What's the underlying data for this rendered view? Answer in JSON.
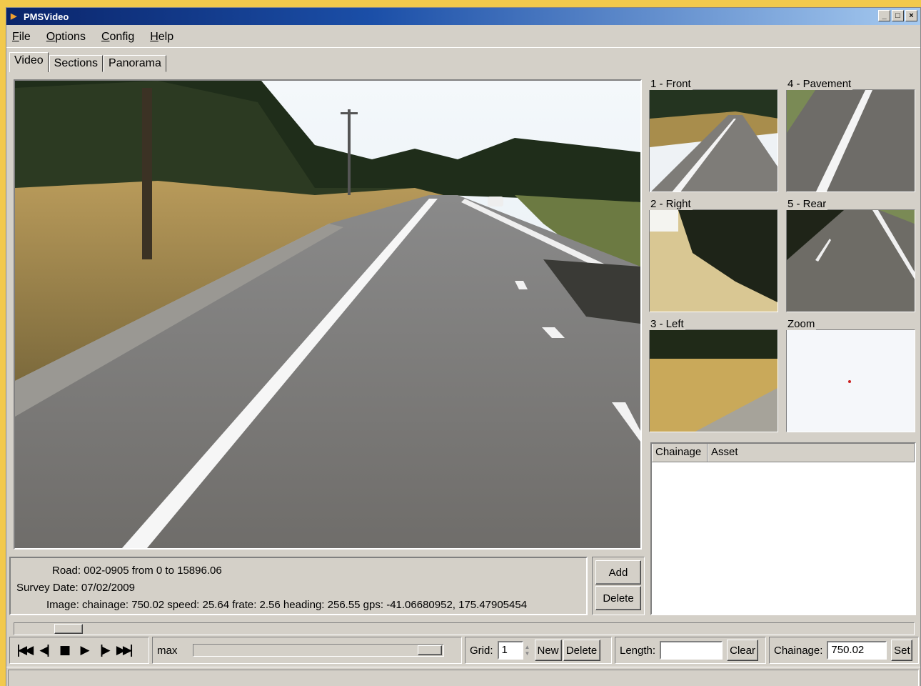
{
  "window": {
    "title": "PMSVideo",
    "controls": [
      "minimize",
      "maximize",
      "close"
    ]
  },
  "menu": {
    "items": [
      "File",
      "Options",
      "Config",
      "Help"
    ]
  },
  "tabs": [
    {
      "label": "Video",
      "active": true
    },
    {
      "label": "Sections"
    },
    {
      "label": "Panorama"
    }
  ],
  "cameras": {
    "front": "1 - Front",
    "right": "2 - Right",
    "left": "3 - Left",
    "pavement": "4 - Pavement",
    "rear": "5 - Rear",
    "zoom": "Zoom"
  },
  "asset_table": {
    "columns": [
      "Chainage",
      "Asset"
    ],
    "rows": []
  },
  "info": {
    "road": "Road: 002-0905 from 0 to 15896.06",
    "survey_date": "Survey Date: 07/02/2009",
    "image": "Image: chainage: 750.02   speed: 25.64   frate: 2.56   heading: 256.55   gps: -41.06680952, 175.47905454"
  },
  "buttons": {
    "add": "Add",
    "delete_asset": "Delete"
  },
  "playback": {
    "icons": [
      "skip-to-start-icon",
      "step-back-icon",
      "stop-icon",
      "play-icon",
      "step-forward-icon",
      "skip-to-end-icon"
    ],
    "glyphs": [
      "|◀◀",
      "◀|",
      "■",
      "▶",
      "|▶",
      "▶▶|"
    ],
    "speed_label": "max"
  },
  "grid": {
    "label": "Grid:",
    "value": "1",
    "new_label": "New",
    "delete_label": "Delete"
  },
  "length": {
    "label": "Length:",
    "value": "",
    "clear_label": "Clear"
  },
  "chainage": {
    "label": "Chainage:",
    "value": "750.02",
    "set_label": "Set"
  },
  "colors": {
    "title_start": "#0a246a",
    "title_end": "#a6caf0",
    "face": "#d4d0c8",
    "page_bg": "#f2c94c"
  }
}
